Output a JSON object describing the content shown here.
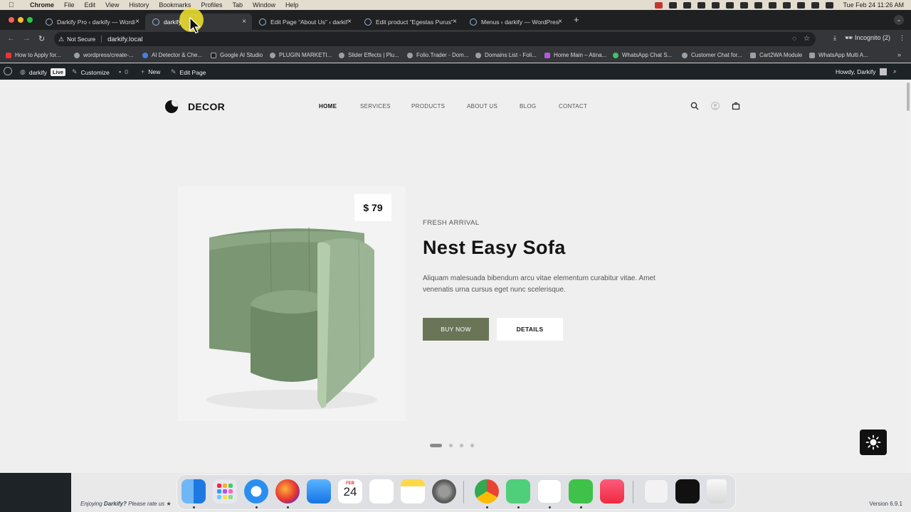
{
  "menubar": {
    "app": "Chrome",
    "items": [
      "File",
      "Edit",
      "View",
      "History",
      "Bookmarks",
      "Profiles",
      "Tab",
      "Window",
      "Help"
    ],
    "clock": "Tue Feb 24  11:26 AM"
  },
  "tabs": [
    {
      "title": "Darkify Pro ‹ darkify — Wordi",
      "active": false
    },
    {
      "title": "darkify",
      "active": true
    },
    {
      "title": "Edit Page “About Us” ‹ darkif",
      "active": false
    },
    {
      "title": "Edit product “Egestas Purus”",
      "active": false
    },
    {
      "title": "Menus ‹ darkify — WordPress",
      "active": false
    }
  ],
  "omnibox": {
    "security_label": "Not Secure",
    "url": "darkify.local"
  },
  "toolbar": {
    "incognito_label": "Incognito (2)"
  },
  "bookmarks": [
    "How to Apply for...",
    "wordpress/create-...",
    "AI Detector & Che...",
    "Google AI Studio",
    "PLUGIN MARKETI...",
    "Slider Effects | Plu...",
    "Folio.Trader - Dom...",
    "Domains List - Foli...",
    "Home Main – Atina...",
    "WhatsApp Chat S...",
    "Customer Chat for...",
    "Cart2WA Module",
    "WhatsApp Multi A..."
  ],
  "adminbar": {
    "site": "darkify",
    "live_badge": "Live",
    "customize": "Customize",
    "comments_count": "0",
    "new": "New",
    "edit_page": "Edit Page",
    "howdy": "Howdy, Darkify"
  },
  "site": {
    "logo": "DECOR",
    "nav": [
      "HOME",
      "SERVICES",
      "PRODUCTS",
      "ABOUT US",
      "BLOG",
      "CONTACT"
    ],
    "current_nav": "HOME"
  },
  "hero": {
    "price": "$ 79",
    "kicker": "FRESH ARRIVAL",
    "headline": "Nest Easy Sofa",
    "description": "Aliquam malesuada bibendum arcu vitae elementum curabitur vitae. Amet venenatis urna cursus eget nunc scelerisque.",
    "buy_label": "BUY NOW",
    "details_label": "DETAILS",
    "slide_count": 4,
    "active_slide": 1,
    "product_color": "#7a9673",
    "accent_color": "#6a7558"
  },
  "footer": {
    "rate_text_prefix": "Enjoying ",
    "rate_brand": "Darkify?",
    "rate_text_suffix": " Please rate us ★",
    "version": "Version 6.9.1"
  },
  "dock": {
    "calendar_month": "FEB",
    "calendar_day": "24"
  }
}
